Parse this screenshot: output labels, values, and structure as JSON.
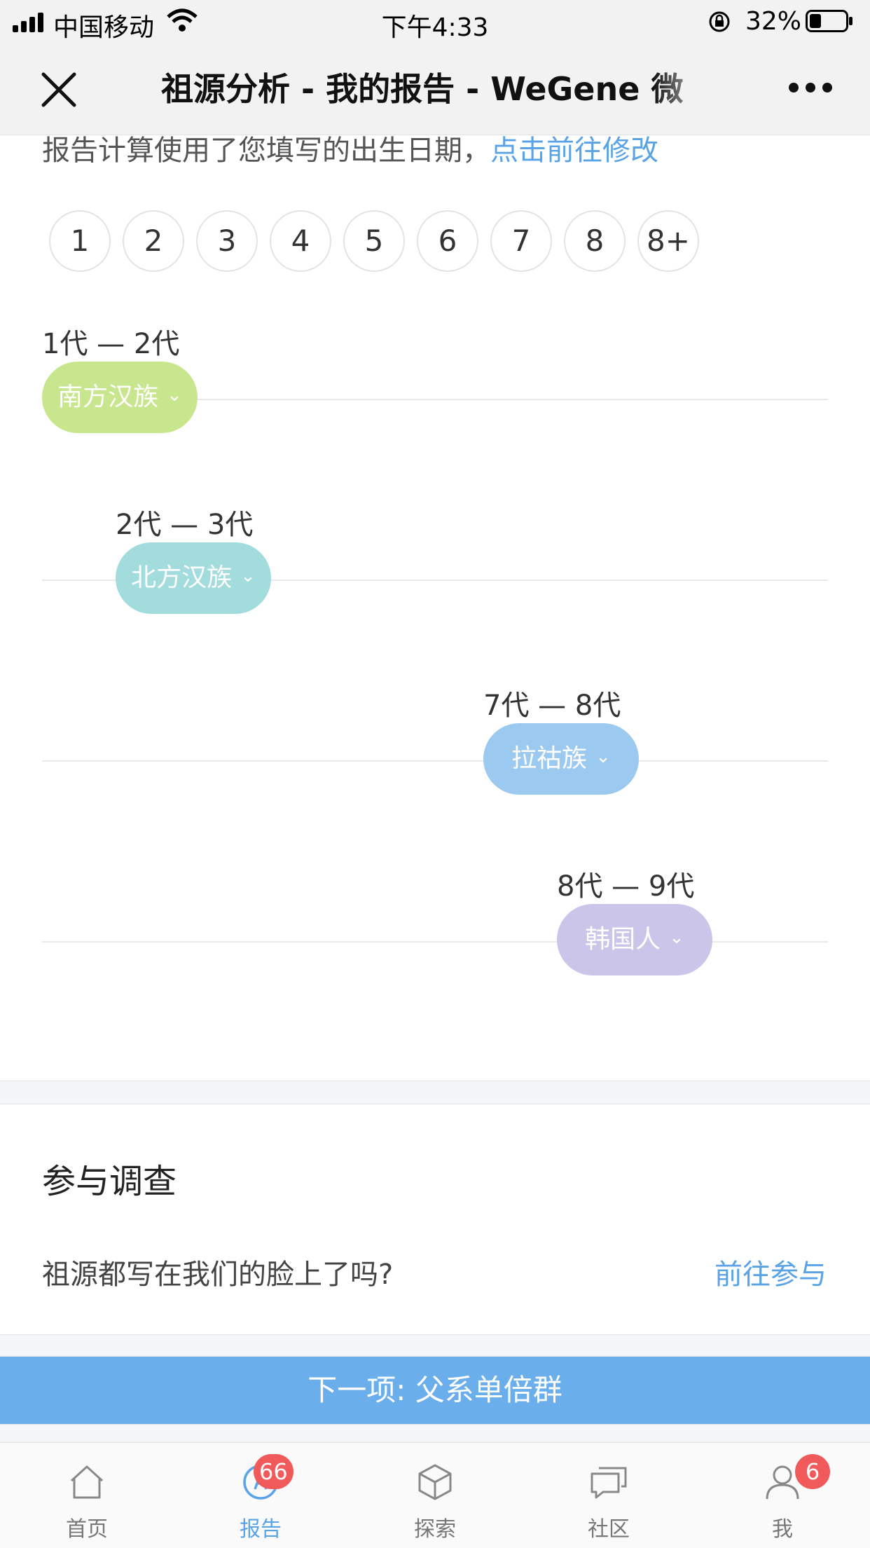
{
  "status_bar": {
    "carrier": "中国移动",
    "time": "下午4:33",
    "battery": "32%",
    "battery_level": 0.32
  },
  "nav": {
    "title": "祖源分析 - 我的报告 - WeGene 微",
    "close_icon": "close-icon",
    "more_icon": "more-icon"
  },
  "note": {
    "text": "报告计算使用了您填写的出生日期，",
    "link": "点击前往修改"
  },
  "generation_tabs": [
    "1",
    "2",
    "3",
    "4",
    "5",
    "6",
    "7",
    "8",
    "8+"
  ],
  "timeline": [
    {
      "range": "1代 — 2代",
      "ethnicity": "南方汉族",
      "color": "#c8e68d"
    },
    {
      "range": "2代 — 3代",
      "ethnicity": "北方汉族",
      "color": "#a2dcdc"
    },
    {
      "range": "7代 — 8代",
      "ethnicity": "拉祜族",
      "color": "#9cc9ef"
    },
    {
      "range": "8代 — 9代",
      "ethnicity": "韩国人",
      "color": "#cbc5ea"
    }
  ],
  "survey": {
    "title": "参与调查",
    "question": "祖源都写在我们的脸上了吗?",
    "link": "前往参与"
  },
  "next_button": "下一项: 父系单倍群",
  "tab_bar": [
    {
      "label": "首页",
      "icon": "home-icon"
    },
    {
      "label": "报告",
      "icon": "report-icon",
      "badge": "66",
      "active": true
    },
    {
      "label": "探索",
      "icon": "cube-icon"
    },
    {
      "label": "社区",
      "icon": "chat-icon"
    },
    {
      "label": "我",
      "icon": "user-icon",
      "badge": "6"
    }
  ],
  "colors": {
    "accent": "#5aa3e6",
    "next_button": "#6aaeeb",
    "badge": "#f05a5a"
  }
}
